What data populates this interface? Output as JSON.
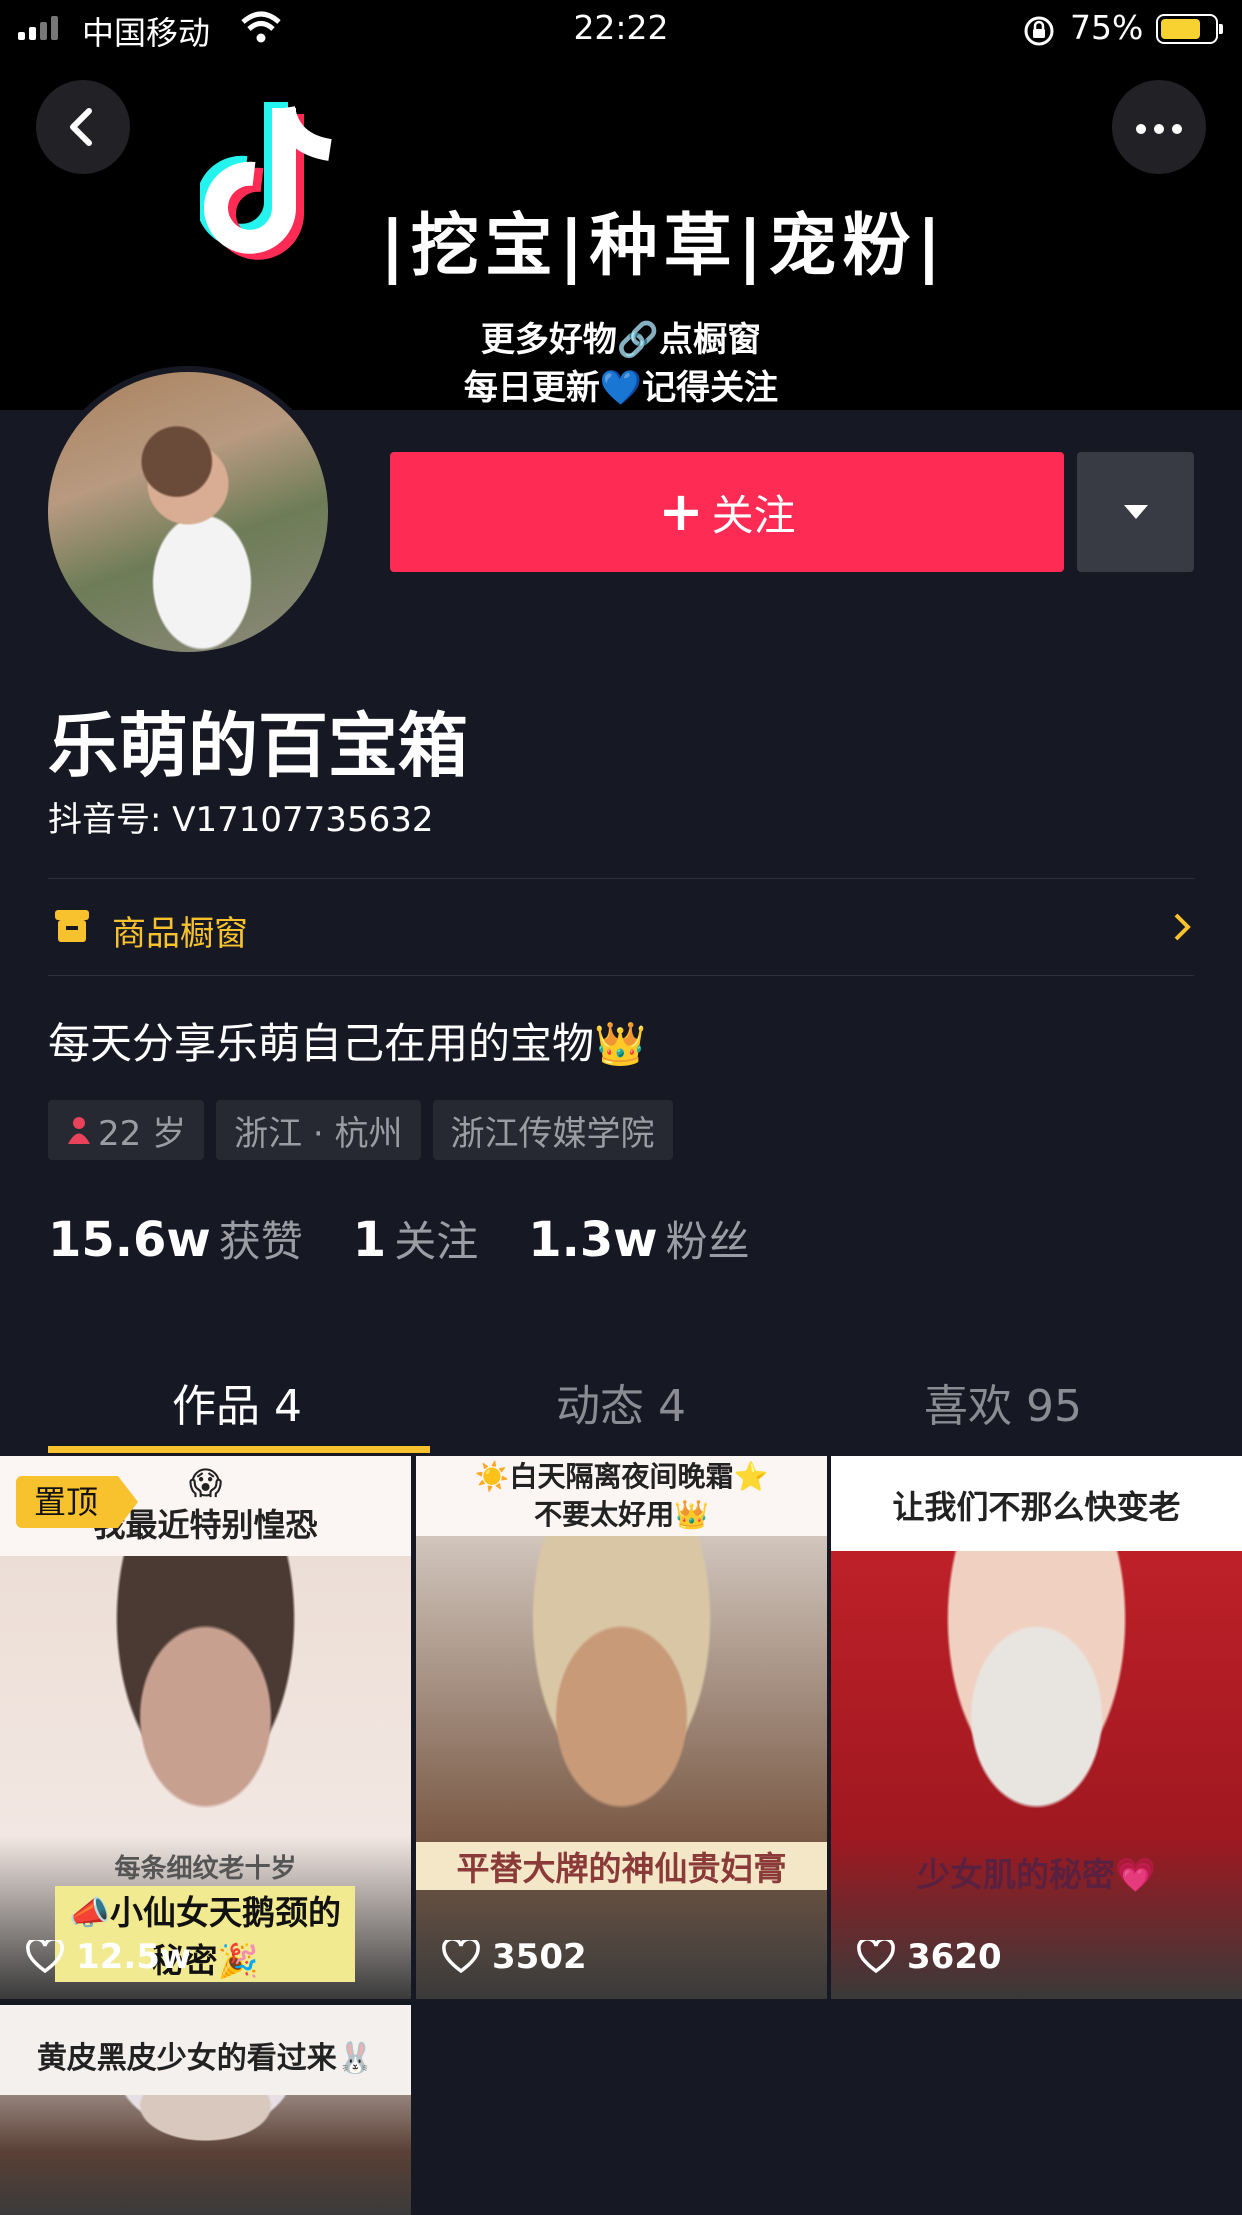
{
  "status_bar": {
    "carrier": "中国移动",
    "time": "22:22",
    "battery": "75%",
    "battery_level": 0.75
  },
  "banner": {
    "slogan": "|挖宝|种草|宠粉|",
    "line1": "更多好物🔗点橱窗",
    "line2": "每日更新💙记得关注"
  },
  "header": {
    "back_icon": "chevron-left-icon",
    "more_icon": "more-dots-icon"
  },
  "follow": {
    "plus": "+",
    "label": "关注",
    "dropdown_icon": "caret-down-icon"
  },
  "profile": {
    "name": "乐萌的百宝箱",
    "douyin_id": "抖音号: V17107735632",
    "shop_label": "商品橱窗",
    "bio": "每天分享乐萌自己在用的宝物👑",
    "tags": [
      {
        "text": "22 岁",
        "icon": "female-icon"
      },
      {
        "text": "浙江 · 杭州"
      },
      {
        "text": "浙江传媒学院"
      }
    ],
    "stats": [
      {
        "num": "15.6w",
        "label": "获赞"
      },
      {
        "num": "1",
        "label": "关注"
      },
      {
        "num": "1.3w",
        "label": "粉丝"
      }
    ]
  },
  "tabs": [
    {
      "label": "作品 4",
      "active": true
    },
    {
      "label": "动态 4",
      "active": false
    },
    {
      "label": "喜欢 95",
      "active": false
    }
  ],
  "videos": [
    {
      "pin": "置顶",
      "caption": "😱\n我最近特别惶恐",
      "sub": "每条细纹老十岁",
      "sub2": "📣小仙女天鹅颈的秘密🎉",
      "likes": "12.5w",
      "colors": [
        "#eadbd2",
        "#c8a090",
        "#f2e7e2",
        "#4a3a33"
      ]
    },
    {
      "caption": "☀️白天隔离夜间晚霜⭐\n不要太好用👑",
      "sub": "平替大牌的神仙贵妇膏",
      "likes": "3502",
      "colors": [
        "#e8e2dc",
        "#c89a78",
        "#7a5a46",
        "#d9c6a4"
      ]
    },
    {
      "caption": "让我们不那么快变老",
      "sub": "少女肌的秘密💗",
      "likes": "3620",
      "colors": [
        "#c8232b",
        "#e8e5e0",
        "#a01820",
        "#f0d0c0"
      ]
    },
    {
      "caption": "黄皮黑皮少女的看过来🐰",
      "colors": [
        "#f2ecea",
        "#d8c8be",
        "#5a4036",
        "#e6e0e6"
      ]
    }
  ]
}
